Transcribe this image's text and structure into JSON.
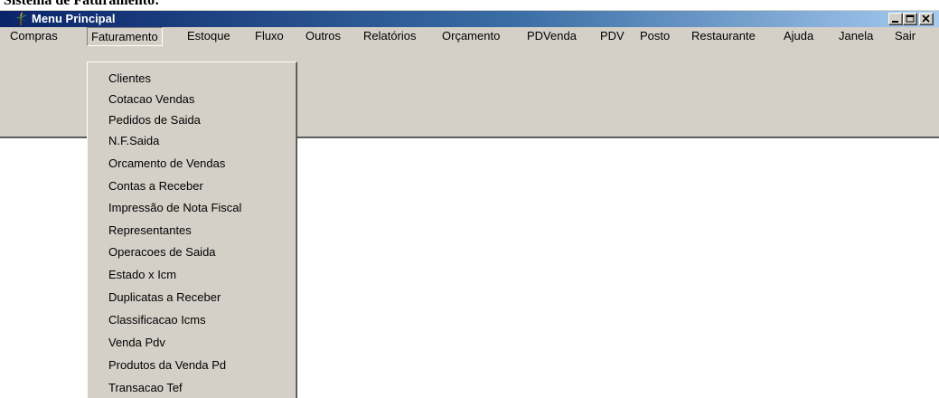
{
  "document": {
    "heading": "Sistema de Faturamento:"
  },
  "window": {
    "title": "Menu Principal",
    "icon": "tree-app-icon",
    "caption_buttons": [
      "minimize-icon",
      "maximize-icon",
      "close-icon"
    ]
  },
  "menubar": {
    "items": [
      {
        "label": "Compras"
      },
      {
        "label": "Faturamento"
      },
      {
        "label": "Estoque"
      },
      {
        "label": "Fluxo"
      },
      {
        "label": "Outros"
      },
      {
        "label": "Relatórios"
      },
      {
        "label": "Orçamento"
      },
      {
        "label": "PDVenda"
      },
      {
        "label": "PDV"
      },
      {
        "label": "Posto"
      },
      {
        "label": "Restaurante"
      },
      {
        "label": "Ajuda"
      },
      {
        "label": "Janela"
      },
      {
        "label": "Sair"
      }
    ],
    "active_index": 1
  },
  "dropdown": {
    "items": [
      {
        "label": "Clientes"
      },
      {
        "label": "Cotacao Vendas"
      },
      {
        "label": "Pedidos de Saida"
      },
      {
        "label": "N.F.Saida"
      },
      {
        "label": "Orcamento de Vendas"
      },
      {
        "label": "Contas a Receber"
      },
      {
        "label": "Impressão de Nota Fiscal"
      },
      {
        "label": "Representantes"
      },
      {
        "label": "Operacoes de Saida"
      },
      {
        "label": "Estado x Icm"
      },
      {
        "label": "Duplicatas a Receber"
      },
      {
        "label": "Classificacao Icms"
      },
      {
        "label": "Venda Pdv"
      },
      {
        "label": "Produtos da Venda Pd"
      },
      {
        "label": "Transacao Tef"
      }
    ]
  },
  "colors": {
    "titlebar_start": "#0a246a",
    "titlebar_end": "#a6caf0",
    "face": "#d4d0c8"
  }
}
